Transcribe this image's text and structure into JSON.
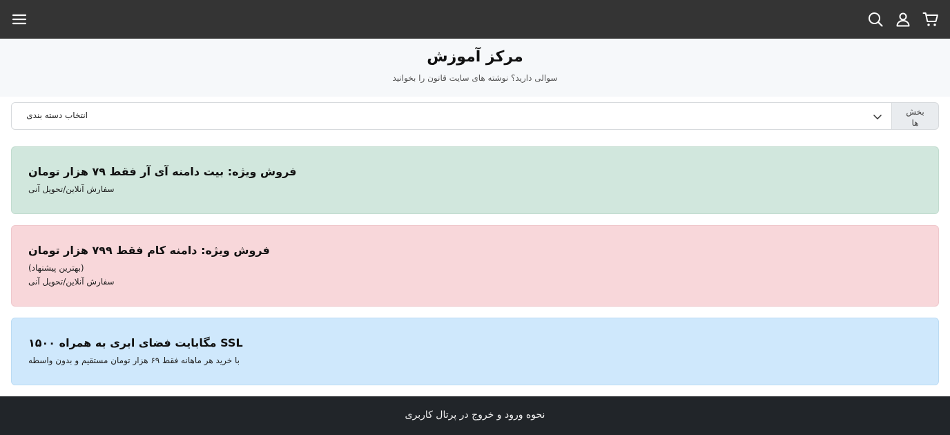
{
  "header": {
    "icons": [
      "menu-icon",
      "search-icon",
      "user-icon",
      "cart-icon"
    ]
  },
  "hero": {
    "title": "مرکز آموزش",
    "subtitle": "سوالی دارید؟ نوشته های سایت قانون را بخوانید"
  },
  "filter": {
    "select_value": "انتخاب دسته بندی",
    "sections_line1": "بخش",
    "sections_line2": "ها"
  },
  "promos": [
    {
      "title": "فروش ویژه: بیت دامنه آی آر فقط ۷۹ هزار تومان",
      "lines": [
        "سفارش آنلاین/تحویل آنی"
      ],
      "color": "#d1e7dd"
    },
    {
      "title": "فروش ویژه: دامنه کام فقط ۷۹۹ هزار تومان",
      "lines": [
        "(بهترین پیشنهاد)",
        "سفارش آنلاین/تحویل آنی"
      ],
      "color": "#f8d7da"
    },
    {
      "title": "SSL مگابایت فضای ابری به همراه ۱۵۰۰",
      "lines": [
        "با خرید هر ماهانه فقط ۶۹ هزار تومان مستقیم و بدون واسطه"
      ],
      "color": "#cfe8fc"
    }
  ],
  "footer": {
    "link": "نحوه ورود و خروج در پرتال کاربری"
  }
}
